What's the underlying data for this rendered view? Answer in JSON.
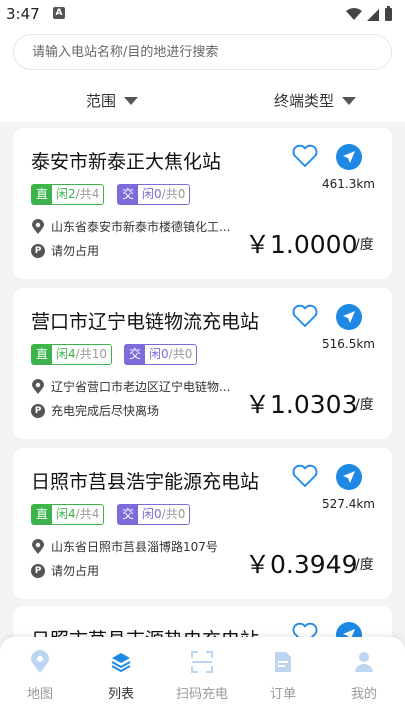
{
  "status_bar": {
    "time": "3:47",
    "notif_letter": "A"
  },
  "search": {
    "placeholder": "请输入电站名称/目的地进行搜索"
  },
  "filters": {
    "range": "范围",
    "terminal_type": "终端类型"
  },
  "stations": [
    {
      "name": "泰安市新泰正大焦化站",
      "distance": "461.3km",
      "dc": {
        "label": "直",
        "free": "闲2",
        "sep": "/",
        "total": "共4"
      },
      "ac": {
        "label": "交",
        "free": "闲0",
        "sep": "/",
        "total": "共0"
      },
      "address": "山东省泰安市新泰市楼德镇化工...",
      "parking": "请勿占用",
      "price": "￥1.0000",
      "unit": "/度"
    },
    {
      "name": "营口市辽宁电链物流充电站",
      "distance": "516.5km",
      "dc": {
        "label": "直",
        "free": "闲4",
        "sep": "/",
        "total": "共10"
      },
      "ac": {
        "label": "交",
        "free": "闲0",
        "sep": "/",
        "total": "共0"
      },
      "address": "辽宁省营口市老边区辽宁电链物...",
      "parking": "充电完成后尽快离场",
      "price": "￥1.0303",
      "unit": "/度"
    },
    {
      "name": "日照市莒县浩宇能源充电站",
      "distance": "527.4km",
      "dc": {
        "label": "直",
        "free": "闲4",
        "sep": "/",
        "total": "共4"
      },
      "ac": {
        "label": "交",
        "free": "闲0",
        "sep": "/",
        "total": "共0"
      },
      "address": "山东省日照市莒县淄博路107号",
      "parking": "请勿占用",
      "price": "￥0.3949",
      "unit": "/度"
    },
    {
      "name": "日照市莒县吉源热电充电站"
    }
  ],
  "tabs": [
    {
      "label": "地图",
      "icon": "map-pin-icon",
      "active": false
    },
    {
      "label": "列表",
      "icon": "layers-icon",
      "active": true
    },
    {
      "label": "扫码充电",
      "icon": "scan-icon",
      "active": false
    },
    {
      "label": "订单",
      "icon": "order-doc-icon",
      "active": false
    },
    {
      "label": "我的",
      "icon": "profile-icon",
      "active": false
    }
  ],
  "colors": {
    "accent_blue": "#1e88e5",
    "dc_green": "#3cb44b",
    "ac_purple": "#7b6cd9"
  }
}
